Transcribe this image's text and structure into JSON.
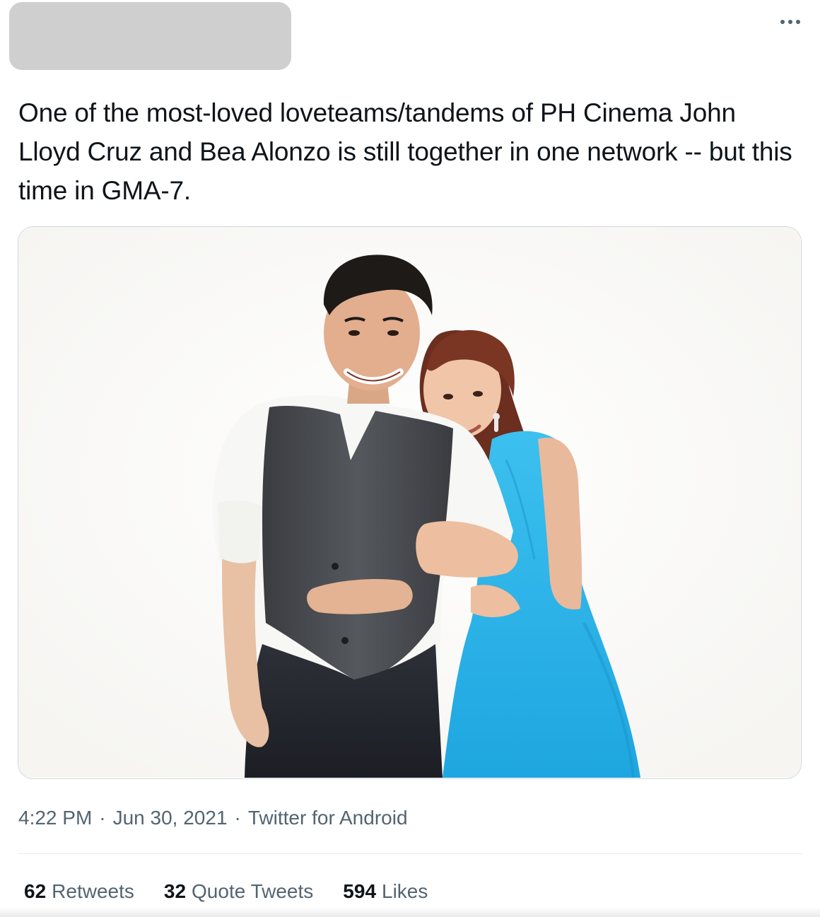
{
  "tweet": {
    "text": "One of the most-loved loveteams/tandems of PH Cinema John Lloyd Cruz and Bea Alonzo is still together in one network -- but this time in GMA-7.",
    "more_icon": "more-horizontal-icon",
    "media": {
      "kind": "photo",
      "description_icon": "photo-of-couple"
    },
    "meta": {
      "time": "4:22 PM",
      "separator": "·",
      "date": "Jun 30, 2021",
      "source": "Twitter for Android"
    },
    "stats": {
      "retweets_count": "62",
      "retweets_label": "Retweets",
      "quotes_count": "32",
      "quotes_label": "Quote Tweets",
      "likes_count": "594",
      "likes_label": "Likes"
    }
  },
  "colors": {
    "text_primary": "#0f1419",
    "text_secondary": "#536471",
    "border": "#cfd9de",
    "redaction": "#cfcfcf",
    "dress_blue": "#2fb4e8"
  }
}
